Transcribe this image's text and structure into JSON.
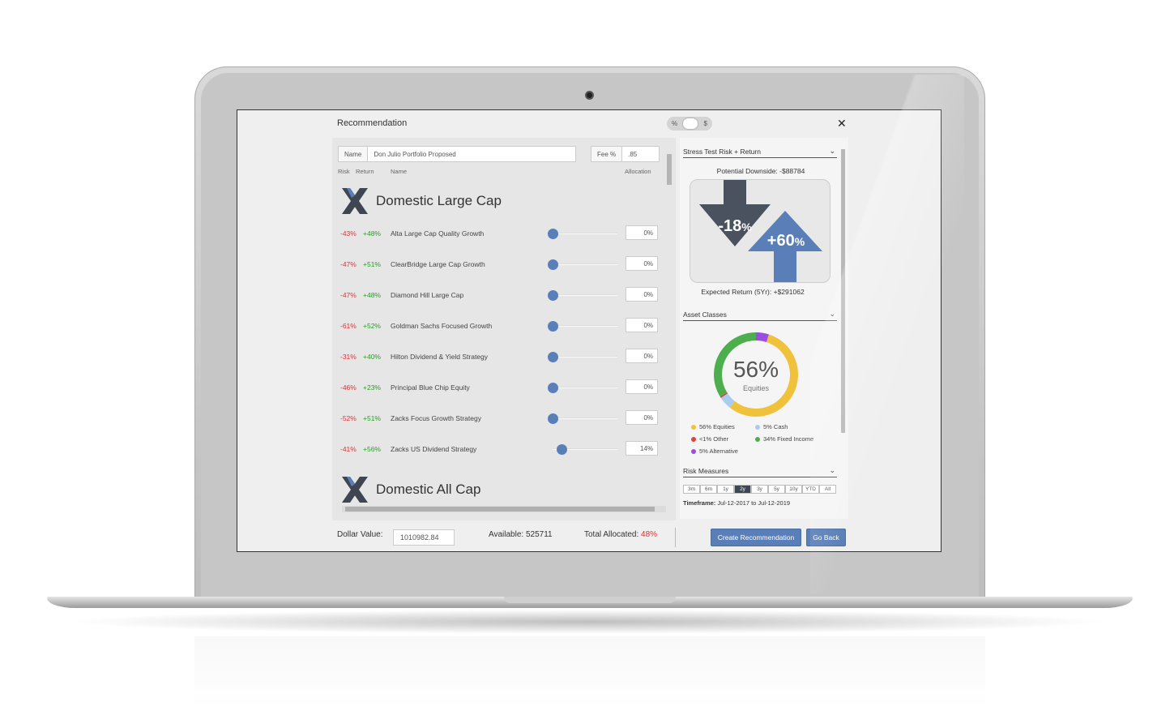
{
  "window": {
    "title": "Recommendation",
    "toggle_left": "%",
    "toggle_right": "$",
    "close": "✕"
  },
  "form": {
    "name_label": "Name",
    "name_value": "Don Julio Portfolio Proposed",
    "fee_label": "Fee %",
    "fee_value": ".85"
  },
  "columns": {
    "risk": "Risk",
    "return": "Return",
    "name": "Name",
    "allocation": "Allocation"
  },
  "groups": [
    {
      "title": "Domestic Large Cap"
    },
    {
      "title": "Domestic All Cap"
    }
  ],
  "funds": [
    {
      "risk": "-43%",
      "ret": "+48%",
      "name": "Alta Large Cap Quality Growth",
      "alloc": "0%",
      "level": 0
    },
    {
      "risk": "-47%",
      "ret": "+51%",
      "name": "ClearBridge Large Cap Growth",
      "alloc": "0%",
      "level": 0
    },
    {
      "risk": "-47%",
      "ret": "+48%",
      "name": "Diamond Hill Large Cap",
      "alloc": "0%",
      "level": 0
    },
    {
      "risk": "-61%",
      "ret": "+52%",
      "name": "Goldman Sachs Focused Growth",
      "alloc": "0%",
      "level": 0
    },
    {
      "risk": "-31%",
      "ret": "+40%",
      "name": "Hilton Dividend & Yield Strategy",
      "alloc": "0%",
      "level": 0
    },
    {
      "risk": "-46%",
      "ret": "+23%",
      "name": "Principal Blue Chip Equity",
      "alloc": "0%",
      "level": 0
    },
    {
      "risk": "-52%",
      "ret": "+51%",
      "name": "Zacks Focus Growth Strategy",
      "alloc": "0%",
      "level": 0
    },
    {
      "risk": "-41%",
      "ret": "+56%",
      "name": "Zacks US Dividend Strategy",
      "alloc": "14%",
      "level": 0.14
    }
  ],
  "stress": {
    "header": "Stress Test Risk + Return",
    "downside": "Potential Downside: -$88784",
    "down_pct": "-18",
    "up_pct": "+60",
    "pct_sign": "%",
    "expected": "Expected Return (5Yr): +$291062"
  },
  "assets": {
    "header": "Asset Classes",
    "center_value": "56%",
    "center_label": "Equities",
    "legend": [
      {
        "label": "56% Equities",
        "color": "#f0c23b"
      },
      {
        "label": "5%   Cash",
        "color": "#a9cdf0"
      },
      {
        "label": "<1% Other",
        "color": "#d9463c"
      },
      {
        "label": "34% Fixed Income",
        "color": "#4cae4c"
      },
      {
        "label": "5%   Alternative",
        "color": "#9b4de0"
      }
    ],
    "slices": [
      {
        "name": "Alternative",
        "pct": 5,
        "color": "#9b4de0"
      },
      {
        "name": "Equities",
        "pct": 56,
        "color": "#f0c23b"
      },
      {
        "name": "Cash",
        "pct": 5,
        "color": "#a9cdf0"
      },
      {
        "name": "Other",
        "pct": 0.6,
        "color": "#d9463c"
      },
      {
        "name": "Fixed Income",
        "pct": 34,
        "color": "#4cae4c"
      }
    ]
  },
  "risk_measures": {
    "header": "Risk Measures",
    "timeframes": [
      "3m",
      "6m",
      "1y",
      "2y",
      "3y",
      "5y",
      "10y",
      "YTD",
      "All"
    ],
    "active": "2y",
    "timeframe_label": "Timeframe:",
    "timeframe_value": "Jul-12-2017 to Jul-12-2019"
  },
  "footer": {
    "dollar_label": "Dollar Value:",
    "dollar_value": "1010982.84",
    "available": "Available: 525711",
    "allocated_label": "Total Allocated: ",
    "allocated_value": "48%",
    "create_btn": "Create Recommendation",
    "back_btn": "Go Back"
  },
  "colors": {
    "accent": "#5a7fb8",
    "arrow_down": "#4a5260",
    "arrow_up": "#5a7fb8",
    "negative": "#dd3333",
    "positive": "#2c9a2c"
  }
}
